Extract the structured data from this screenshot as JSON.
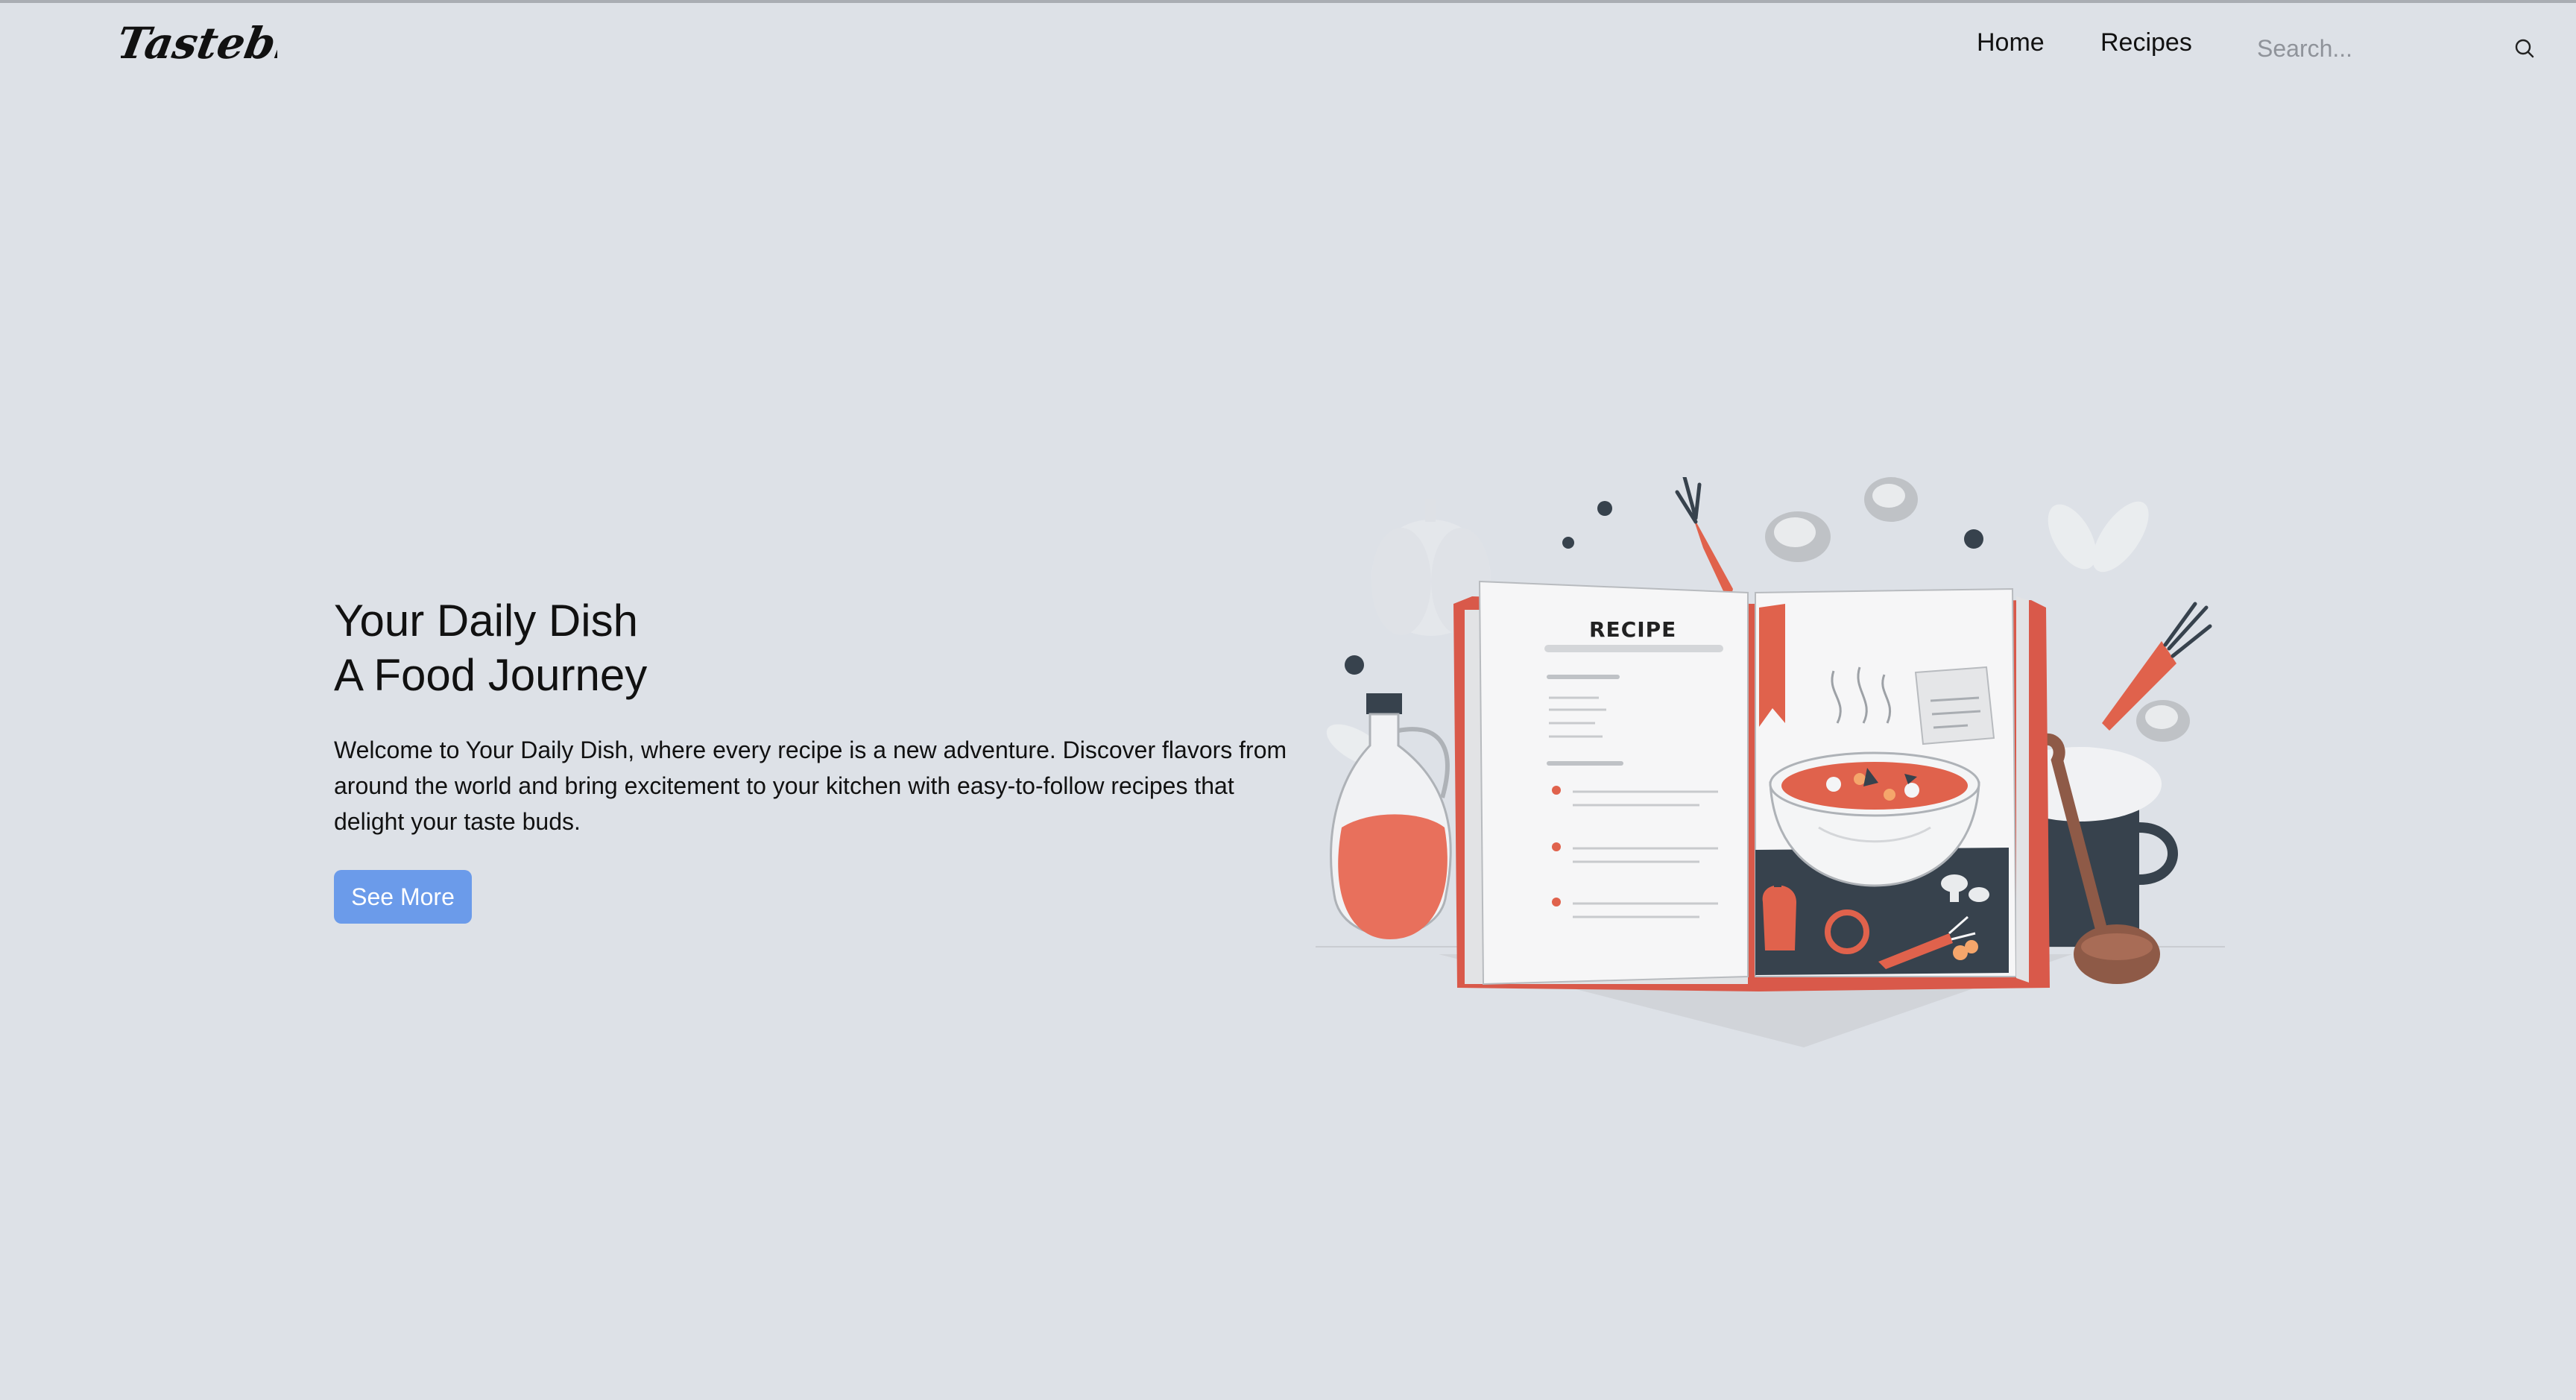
{
  "header": {
    "logo_text": "Tastebite",
    "nav": {
      "home": "Home",
      "recipes": "Recipes"
    },
    "search": {
      "placeholder": "Search...",
      "value": ""
    }
  },
  "hero": {
    "title_line1": "Your Daily Dish",
    "title_line2": "A Food Journey",
    "description": "Welcome to Your Daily Dish, where every recipe is a new adventure. Discover flavors from around the world and bring excitement to your kitchen with easy-to-follow recipes that delight your taste buds.",
    "cta_label": "See More"
  },
  "illustration": {
    "book_heading": "RECIPE",
    "icons": [
      "recipe-book-icon",
      "soup-bowl-icon",
      "carrot-icon",
      "oil-bottle-icon",
      "cooking-pot-icon",
      "ladle-icon",
      "mushroom-icon",
      "pumpkin-icon",
      "bell-pepper-icon"
    ]
  },
  "colors": {
    "background": "#dde1e7",
    "accent": "#6b9bea",
    "illustration_red": "#e0624c",
    "illustration_dark": "#37424d"
  }
}
